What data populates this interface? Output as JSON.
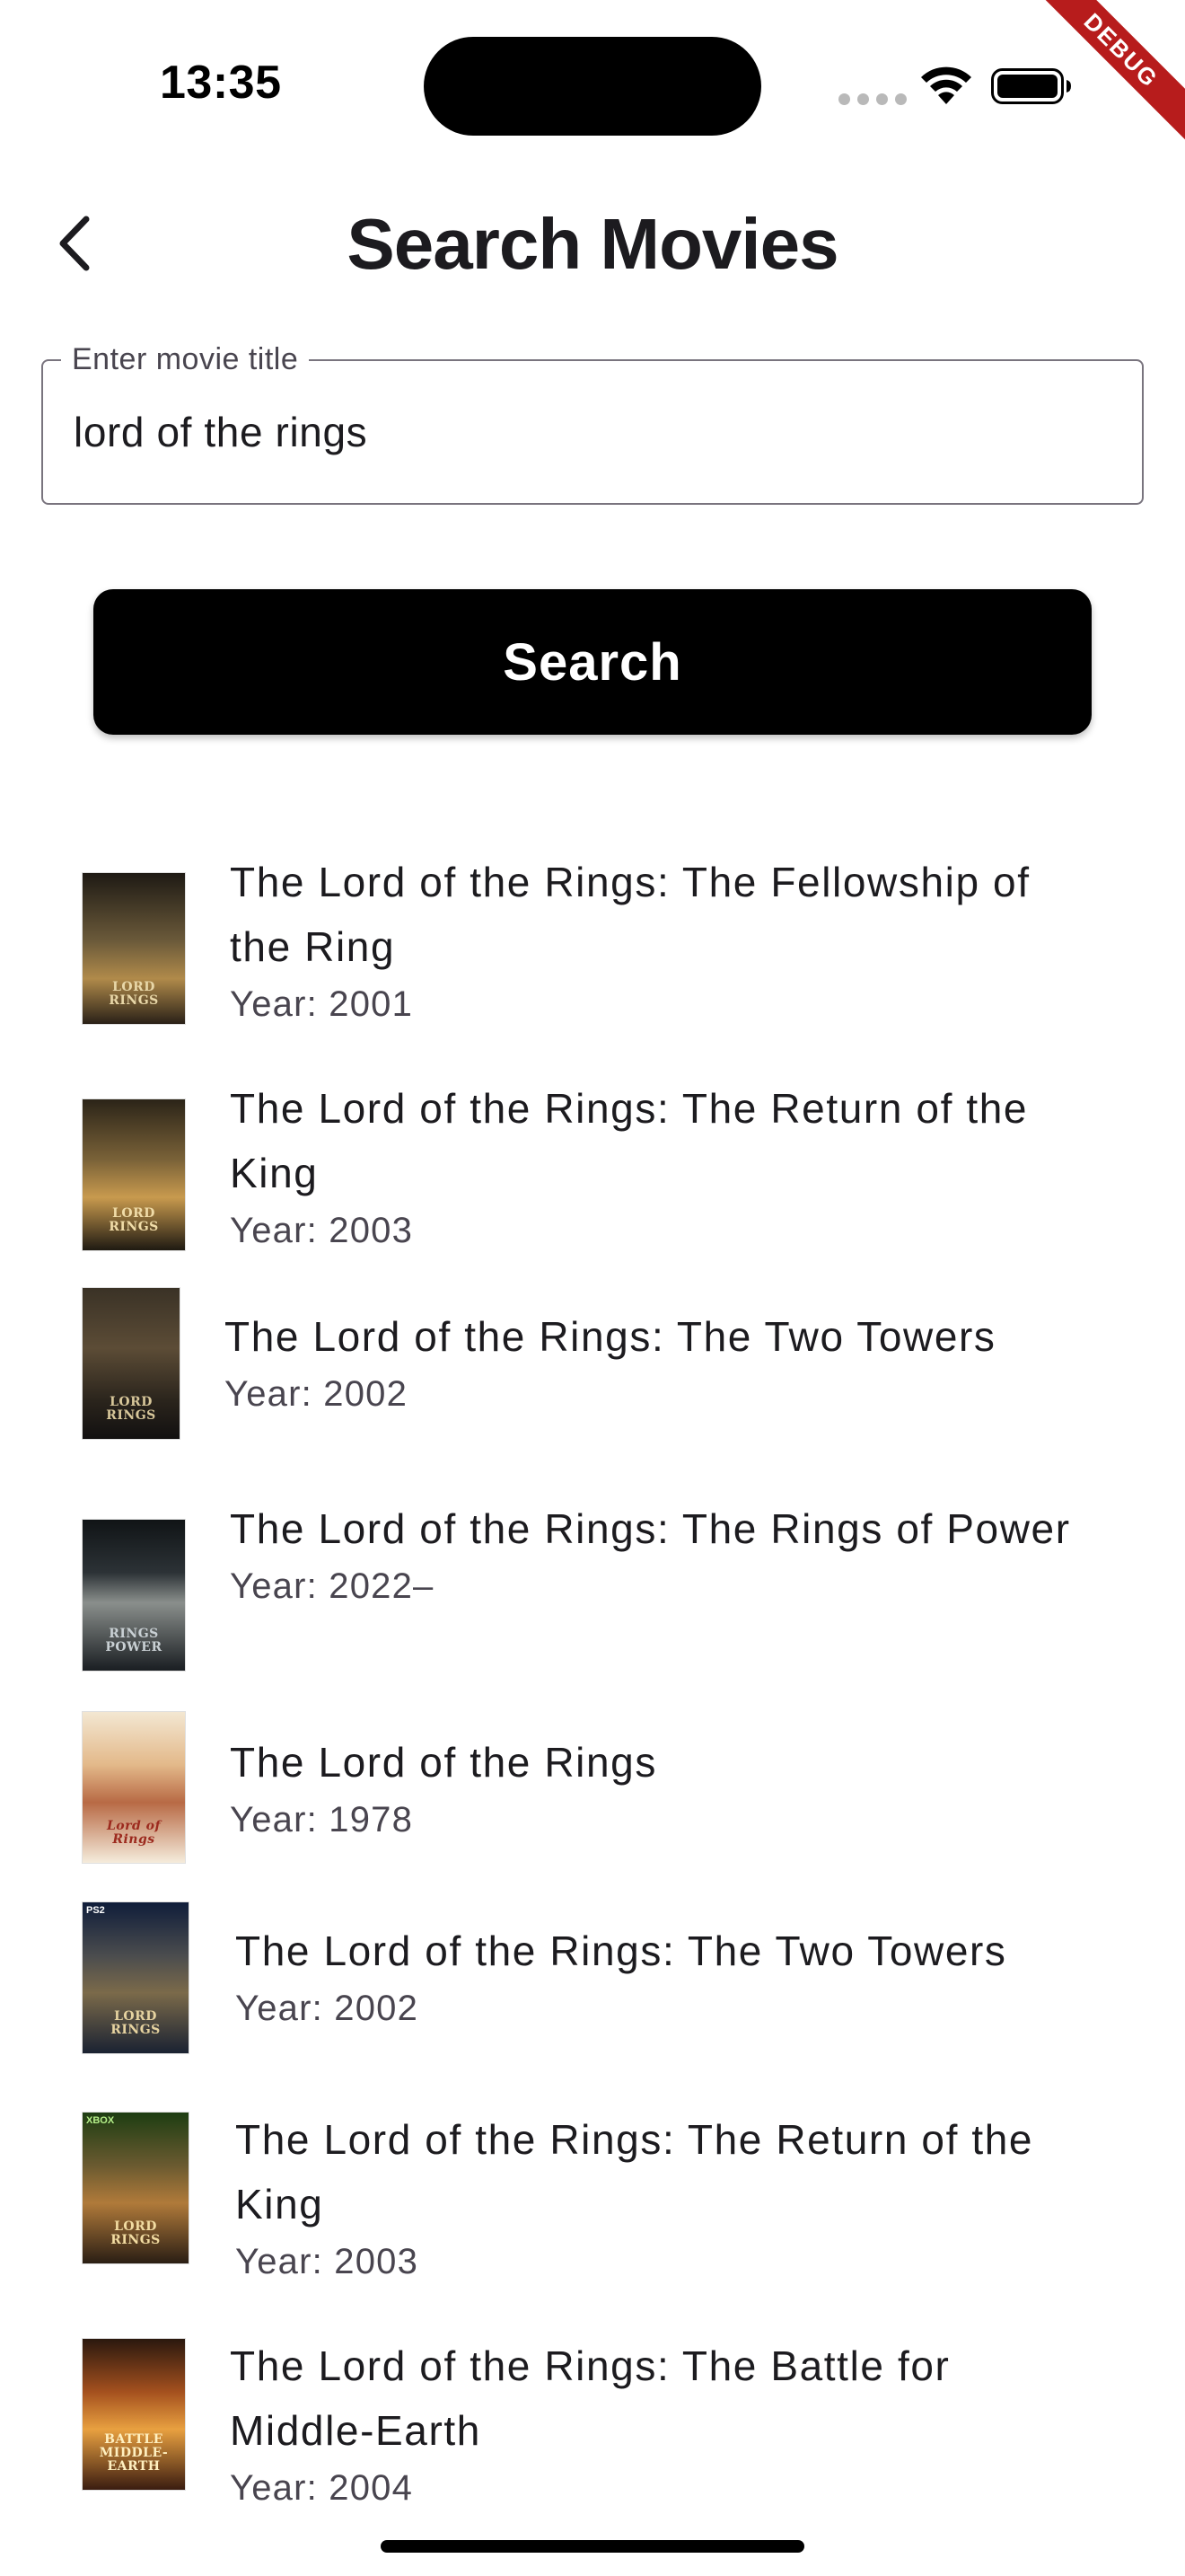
{
  "status_bar": {
    "time": "13:35",
    "debug_label": "DEBUG"
  },
  "app_bar": {
    "title": "Search Movies",
    "back_icon": "chevron-left-icon"
  },
  "search": {
    "label": "Enter movie title",
    "value": "lord of the rings",
    "button_label": "Search"
  },
  "results": [
    {
      "title": "The Lord of the Rings: The Fellowship of the Ring",
      "year": "Year: 2001"
    },
    {
      "title": "The Lord of the Rings: The Return of the King",
      "year": "Year: 2003"
    },
    {
      "title": "The Lord of the Rings: The Two Towers",
      "year": "Year: 2002"
    },
    {
      "title": "The Lord of the Rings: The Rings of Power",
      "year": "Year: 2022–"
    },
    {
      "title": "The Lord of the Rings",
      "year": "Year: 1978"
    },
    {
      "title": "The Lord of the Rings: The Two Towers",
      "year": "Year: 2002"
    },
    {
      "title": "The Lord of the Rings: The Return of the King",
      "year": "Year: 2003"
    },
    {
      "title": "The Lord of the Rings: The Battle for Middle-Earth",
      "year": "Year: 2004"
    }
  ],
  "colors": {
    "background": "#ffffff",
    "button": "#000000",
    "button_text": "#ffffff",
    "field_border": "#79747e",
    "secondary_text": "#49454f",
    "debug_ribbon": "#b71c1c"
  }
}
